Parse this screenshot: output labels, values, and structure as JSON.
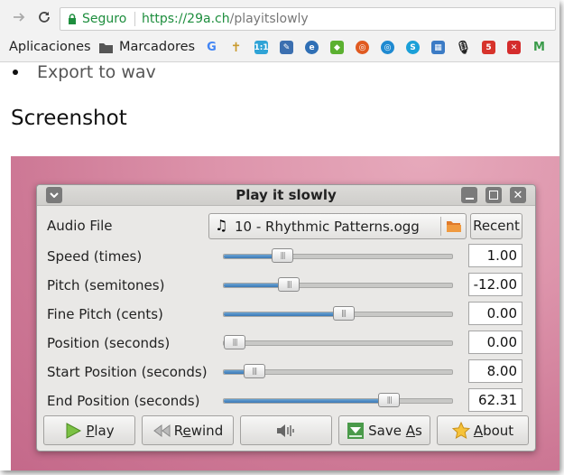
{
  "browser": {
    "security_label": "Seguro",
    "url_scheme_host": "https://29a.ch",
    "url_path": "/playitslowly",
    "bookmarks": {
      "apps_label": "Aplicaciones",
      "bookmarks_label": "Marcadores"
    }
  },
  "page": {
    "bullet_item": "Export to wav",
    "heading": "Screenshot"
  },
  "app": {
    "title": "Play it slowly",
    "audio_file_label": "Audio File",
    "audio_file_value": "10 - Rhythmic Patterns.ogg",
    "recent_label": "Recent",
    "controls": [
      {
        "label": "Speed (times)",
        "value": "1.00",
        "level": 0.22
      },
      {
        "label": "Pitch (semitones)",
        "value": "-12.00",
        "level": 0.25
      },
      {
        "label": "Fine Pitch (cents)",
        "value": "0.00",
        "level": 0.5
      },
      {
        "label": "Position (seconds)",
        "value": "0.00",
        "level": 0.0
      },
      {
        "label": "Start Position (seconds)",
        "value": "8.00",
        "level": 0.09
      },
      {
        "label": "End Position (seconds)",
        "value": "62.31",
        "level": 0.71
      }
    ],
    "buttons": {
      "play_prefix": "",
      "play_mnemonic": "P",
      "play_rest": "lay",
      "rewind_prefix": "R",
      "rewind_mnemonic": "e",
      "rewind_rest": "wind",
      "save_prefix": "Save ",
      "save_mnemonic": "A",
      "save_rest": "s",
      "about_prefix": "",
      "about_mnemonic": "A",
      "about_rest": "bout"
    }
  },
  "colors": {
    "secure_green": "#1e8e3e",
    "slider_fill": "#3a78b5",
    "desktop_pink": "#dd94ab"
  }
}
